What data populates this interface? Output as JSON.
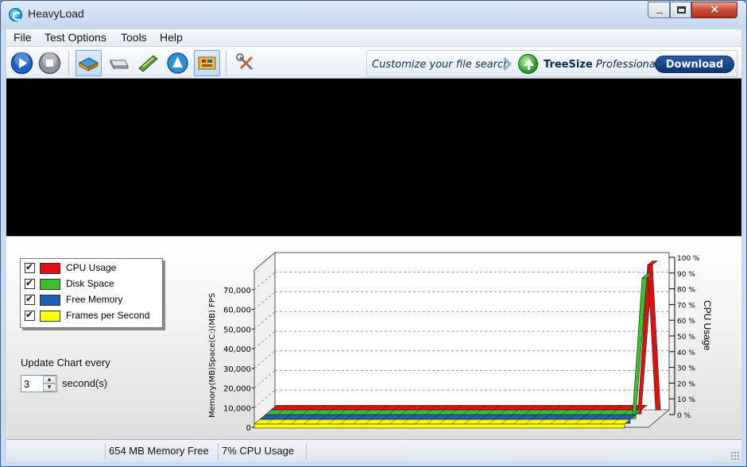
{
  "window": {
    "title": "HeavyLoad",
    "icon": "heavyload-icon"
  },
  "menu": [
    "File",
    "Test Options",
    "Tools",
    "Help"
  ],
  "toolbar": {
    "buttons": [
      {
        "name": "start-icon",
        "active": false
      },
      {
        "name": "stop-icon",
        "active": false
      },
      {
        "name": "cpu-test-icon",
        "active": true
      },
      {
        "name": "disk-icon",
        "active": false
      },
      {
        "name": "memory-icon",
        "active": false
      },
      {
        "name": "gpu-test-icon",
        "active": false
      },
      {
        "name": "fps-test-icon",
        "active": true
      },
      {
        "name": "tools-icon",
        "active": false
      }
    ],
    "banner": {
      "text": "Customize your file search",
      "product_bold": "TreeSize",
      "product_italic": "Professional",
      "button": "Download"
    }
  },
  "legend": [
    {
      "label": "CPU Usage",
      "color": "#e01010",
      "checked": true
    },
    {
      "label": "Disk Space",
      "color": "#3cbf2c",
      "checked": true
    },
    {
      "label": "Free Memory",
      "color": "#1f5fb8",
      "checked": true
    },
    {
      "label": "Frames per Second",
      "color": "#ffff00",
      "checked": true
    }
  ],
  "update": {
    "label": "Update Chart every",
    "value": "3",
    "unit": "second(s)"
  },
  "chart_data": {
    "type": "area",
    "left_axis_label": "Memory(MB)Space(C:)(MB) FPS",
    "right_axis_label": "CPU Usage",
    "left_ticks": [
      "0",
      "10,000",
      "20,000",
      "30,000",
      "40,000",
      "50,000",
      "60,000",
      "70,000"
    ],
    "right_ticks": [
      "0 %",
      "10 %",
      "20 %",
      "30 %",
      "40 %",
      "50 %",
      "60 %",
      "70 %",
      "80 %",
      "90 %",
      "100 %"
    ],
    "left_ylim": [
      0,
      80000
    ],
    "right_ylim": [
      0,
      100
    ],
    "grid": true,
    "points": 30,
    "series": [
      {
        "name": "CPU Usage",
        "color": "#e01010",
        "end_value_pct": 97
      },
      {
        "name": "Disk Space",
        "color": "#3cbf2c",
        "end_value_pct": 88
      },
      {
        "name": "Free Memory",
        "color": "#1f5fb8"
      },
      {
        "name": "Frames per Second",
        "color": "#ffff00"
      }
    ]
  },
  "status": {
    "memory": "654 MB Memory Free",
    "cpu": "7% CPU Usage"
  }
}
